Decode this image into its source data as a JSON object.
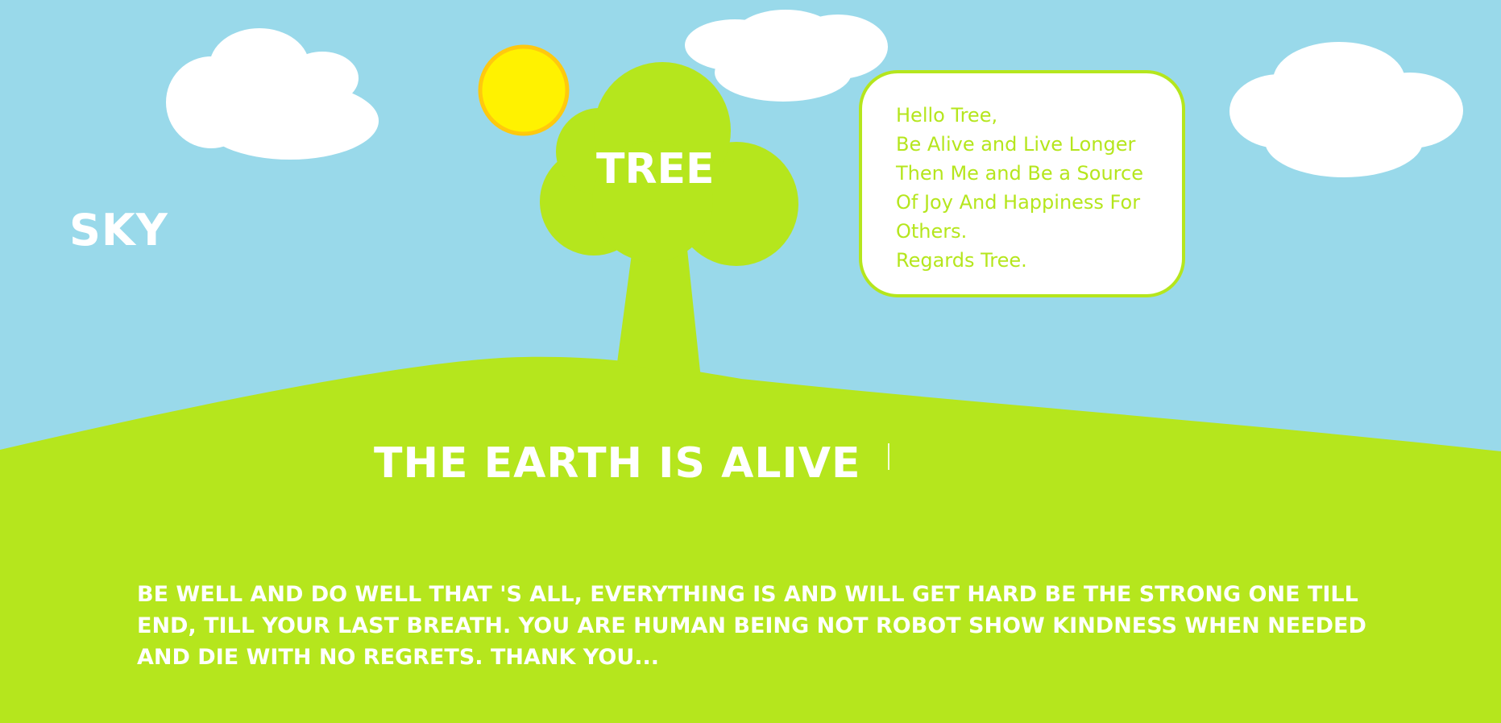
{
  "labels": {
    "sky": "SKY",
    "tree": "TREE",
    "earth": "THE EARTH IS ALIVE"
  },
  "letter": {
    "lines": [
      "Hello Tree,",
      "Be Alive and Live Longer",
      "Then Me and Be a Source",
      "Of Joy And Happiness For",
      "Others.",
      "Regards Tree."
    ]
  },
  "message": {
    "lines": [
      "Be well and do well that 's all, everything is and will get hard be the strong one till",
      "end, till your last breath. You are human being not robot show kindness when needed",
      "and die with no regrets. Thank you..."
    ]
  },
  "colors": {
    "sky": "#99d9ea",
    "grass": "#b5e61d",
    "sun": "#fff200",
    "sun_outline": "#ffc90e",
    "cloud": "#ffffff",
    "text": "#ffffff"
  },
  "icons": {
    "sun": "sun-icon",
    "cloud": "cloud-icon",
    "tree": "tree-icon"
  }
}
